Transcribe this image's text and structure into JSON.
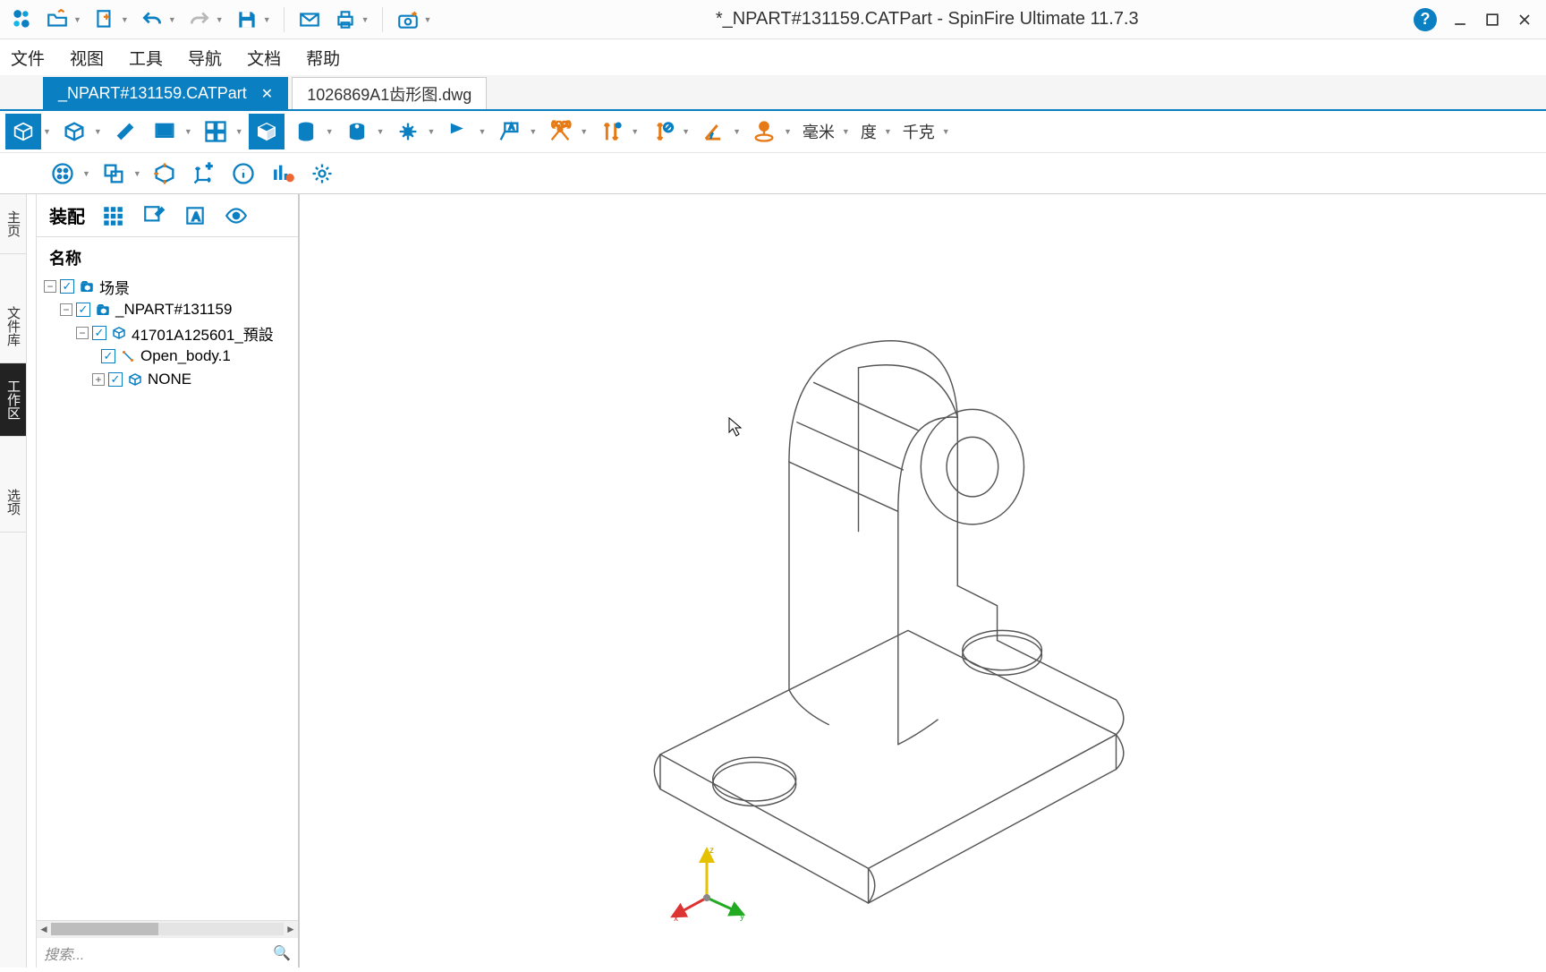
{
  "title": "*_NPART#131159.CATPart - SpinFire Ultimate 11.7.3",
  "menu": {
    "file": "文件",
    "view": "视图",
    "tools": "工具",
    "nav": "导航",
    "doc": "文档",
    "help": "帮助"
  },
  "tabs": {
    "active": "_NPART#131159.CATPart",
    "other": "1026869A1齿形图.dwg"
  },
  "units": {
    "length": "毫米",
    "angle": "度",
    "mass": "千克"
  },
  "panel": {
    "assembly": "装配",
    "nameHeader": "名称"
  },
  "tree": {
    "scene": "场景",
    "part": "_NPART#131159",
    "sub": "41701A125601_預設",
    "body": "Open_body.1",
    "none": "NONE"
  },
  "search": {
    "placeholder": "搜索..."
  },
  "sidetabs": {
    "home": "主页",
    "lib": "文件库",
    "work": "工作区",
    "opt": "选项"
  },
  "triad": {
    "x": "x",
    "y": "y",
    "z": "z"
  },
  "colors": {
    "accent": "#0a7fc2",
    "orange": "#e67a17"
  }
}
